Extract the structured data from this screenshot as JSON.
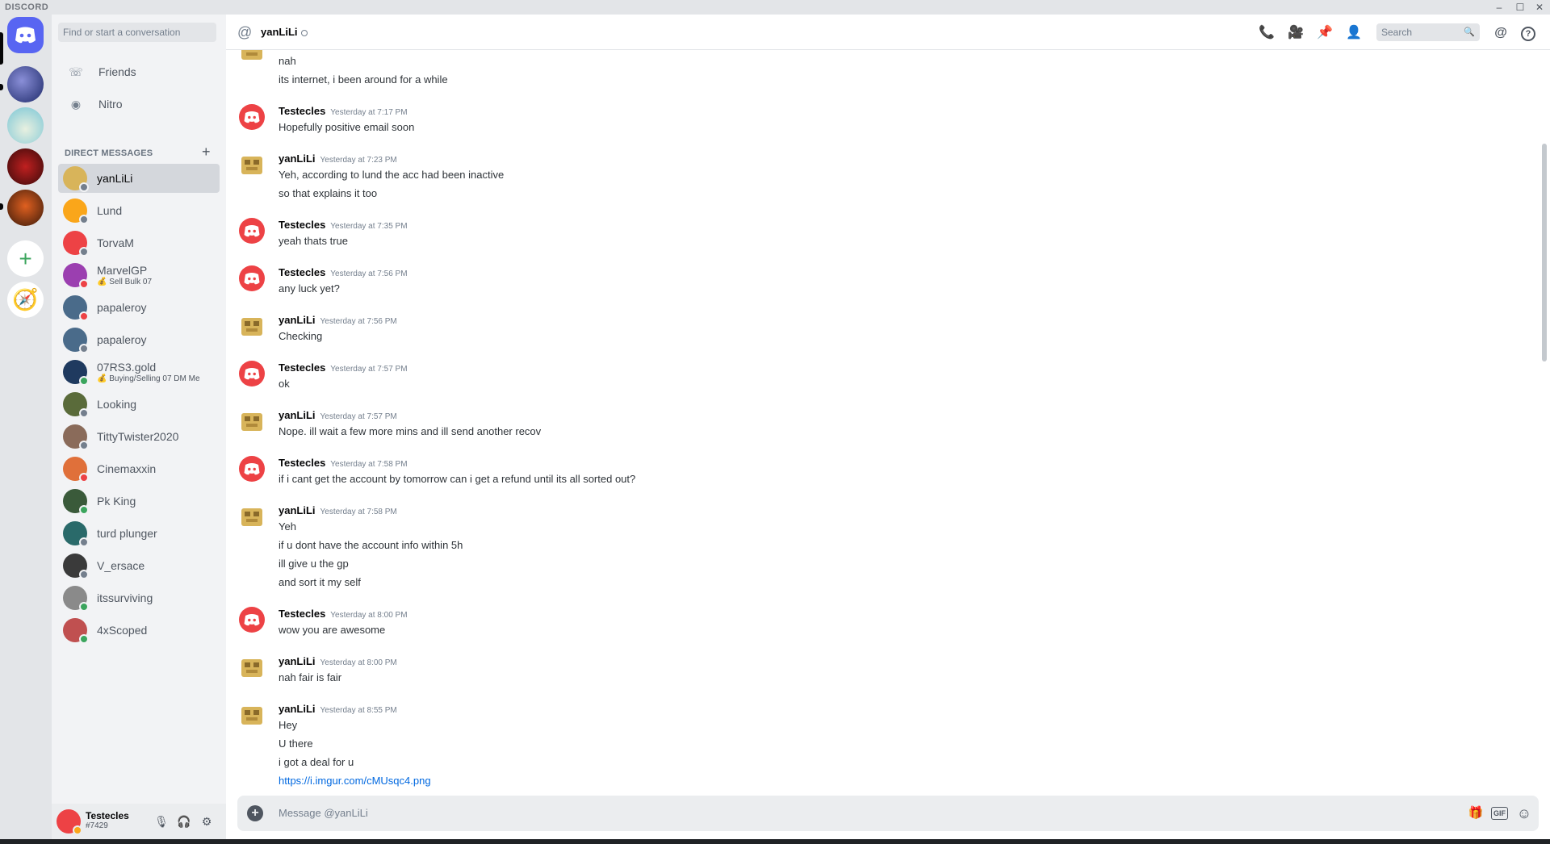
{
  "window": {
    "brand": "DISCORD",
    "minimize_glyph": "–",
    "maximize_glyph": "☐",
    "close_glyph": "✕"
  },
  "colors": {
    "accent": "#5865f2",
    "online": "#3ba55d",
    "dnd": "#ed4245",
    "idle_offline": "#747f8d",
    "link": "#0068e0"
  },
  "servers": {
    "home_icon": "discord-logo-icon",
    "add_glyph": "+",
    "explore_glyph": "🧭"
  },
  "sidebar": {
    "search_placeholder": "Find or start a conversation",
    "nav": [
      {
        "label": "Friends",
        "icon": "friends-icon",
        "glyph": "☏"
      },
      {
        "label": "Nitro",
        "icon": "nitro-icon",
        "glyph": "◉"
      }
    ],
    "dm_header": "DIRECT MESSAGES",
    "dm_add_glyph": "+",
    "dms": [
      {
        "name": "yanLiLi",
        "sub": "",
        "status": "offline",
        "color": "#d8b45a"
      },
      {
        "name": "Lund",
        "sub": "",
        "status": "offline",
        "color": "#faa61a"
      },
      {
        "name": "TorvaM",
        "sub": "",
        "status": "offline",
        "color": "#ed4245"
      },
      {
        "name": "MarvelGP",
        "sub": "💰 Sell Bulk 07",
        "status": "dnd",
        "color": "#9b3fb0"
      },
      {
        "name": "papaleroy",
        "sub": "",
        "status": "dnd",
        "color": "#4a6b8a"
      },
      {
        "name": "papaleroy",
        "sub": "",
        "status": "offline",
        "color": "#4a6b8a"
      },
      {
        "name": "07RS3.gold",
        "sub": "💰 Buying/Selling 07 DM Me",
        "status": "online",
        "color": "#1f3a5f"
      },
      {
        "name": "Looking",
        "sub": "",
        "status": "offline",
        "color": "#5a6b3a"
      },
      {
        "name": "TittyTwister2020",
        "sub": "",
        "status": "offline",
        "color": "#8a6b5a"
      },
      {
        "name": "Cinemaxxin",
        "sub": "",
        "status": "dnd",
        "color": "#e0703a"
      },
      {
        "name": "Pk King",
        "sub": "",
        "status": "online",
        "color": "#3a5a3a"
      },
      {
        "name": "turd plunger",
        "sub": "",
        "status": "offline",
        "color": "#2a6a6a"
      },
      {
        "name": "V_ersace",
        "sub": "",
        "status": "offline",
        "color": "#3a3a3a"
      },
      {
        "name": "itssurviving",
        "sub": "",
        "status": "online",
        "color": "#8a8a8a"
      },
      {
        "name": "4xScoped",
        "sub": "",
        "status": "online",
        "color": "#c05050"
      }
    ]
  },
  "user_panel": {
    "name": "Testecles",
    "tag": "#7429",
    "mic_icon": "microphone-icon",
    "headset_icon": "headphones-icon",
    "settings_icon": "gear-icon",
    "mic_glyph": "🎙",
    "headset_glyph": "🎧",
    "settings_glyph": "⚙"
  },
  "header": {
    "at_glyph": "@",
    "title": "yanLiLi",
    "search_placeholder": "Search",
    "search_glyph": "🔍",
    "icons": [
      {
        "name": "voice-call-icon",
        "glyph": "📞"
      },
      {
        "name": "video-call-icon",
        "glyph": "🎥"
      },
      {
        "name": "pinned-messages-icon",
        "glyph": "📌"
      },
      {
        "name": "add-friend-to-dm-icon",
        "glyph": "👤"
      },
      {
        "name": "mentions-icon",
        "glyph": "@"
      },
      {
        "name": "help-icon",
        "glyph": "?"
      }
    ]
  },
  "messages": [
    {
      "author": "",
      "time": "",
      "avatar": "yan",
      "lines": [
        "nah",
        "its internet, i been around for a while"
      ],
      "partial": true
    },
    {
      "author": "Testecles",
      "time": "Yesterday at 7:17 PM",
      "avatar": "test",
      "lines": [
        "Hopefully positive email soon"
      ]
    },
    {
      "author": "yanLiLi",
      "time": "Yesterday at 7:23 PM",
      "avatar": "yan",
      "lines": [
        "Yeh, according to lund the acc had been inactive",
        "so that explains it too"
      ]
    },
    {
      "author": "Testecles",
      "time": "Yesterday at 7:35 PM",
      "avatar": "test",
      "lines": [
        "yeah thats true"
      ]
    },
    {
      "author": "Testecles",
      "time": "Yesterday at 7:56 PM",
      "avatar": "test",
      "lines": [
        "any luck yet?"
      ]
    },
    {
      "author": "yanLiLi",
      "time": "Yesterday at 7:56 PM",
      "avatar": "yan",
      "lines": [
        "Checking"
      ]
    },
    {
      "author": "Testecles",
      "time": "Yesterday at 7:57 PM",
      "avatar": "test",
      "lines": [
        "ok"
      ]
    },
    {
      "author": "yanLiLi",
      "time": "Yesterday at 7:57 PM",
      "avatar": "yan",
      "lines": [
        "Nope. ill wait a few more mins and ill send another recov"
      ]
    },
    {
      "author": "Testecles",
      "time": "Yesterday at 7:58 PM",
      "avatar": "test",
      "lines": [
        "if i cant get the account by tomorrow can i get a refund until its all sorted out?"
      ]
    },
    {
      "author": "yanLiLi",
      "time": "Yesterday at 7:58 PM",
      "avatar": "yan",
      "lines": [
        "Yeh",
        "if u dont have the account info within 5h",
        "ill give u the gp",
        "and sort it my self"
      ]
    },
    {
      "author": "Testecles",
      "time": "Yesterday at 8:00 PM",
      "avatar": "test",
      "lines": [
        "wow you are awesome"
      ]
    },
    {
      "author": "yanLiLi",
      "time": "Yesterday at 8:00 PM",
      "avatar": "yan",
      "lines": [
        "nah fair is fair"
      ]
    },
    {
      "author": "yanLiLi",
      "time": "Yesterday at 8:55 PM",
      "avatar": "yan",
      "lines": [
        "Hey",
        "U there",
        "i got a deal for u"
      ],
      "link": "https://i.imgur.com/cMUsqc4.png"
    }
  ],
  "composer": {
    "placeholder": "Message @yanLiLi",
    "add_glyph": "+",
    "gift_icon": "gift-icon",
    "gift_glyph": "🎁",
    "gif_label": "GIF",
    "emoji_icon": "emoji-icon",
    "emoji_glyph": "☺"
  }
}
